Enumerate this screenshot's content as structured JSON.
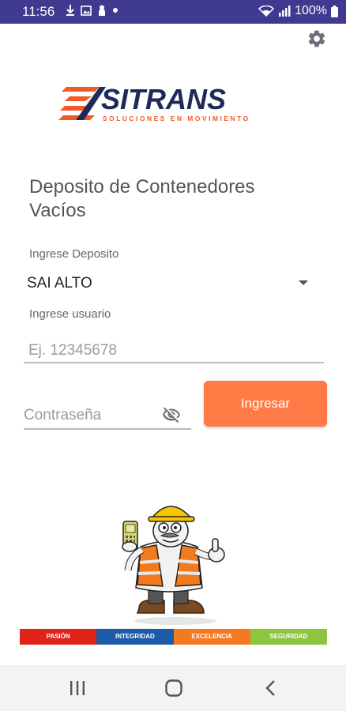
{
  "status_bar": {
    "time": "11:56",
    "battery": "100%",
    "background": "#3f3a8f"
  },
  "header": {
    "settings_icon": "gear-icon"
  },
  "logo": {
    "brand": "SITRANS",
    "tagline": "SOLUCIONES EN MOVIMIENTO"
  },
  "page": {
    "title": "Deposito de Contenedores Vacíos"
  },
  "form": {
    "deposito_label": "Ingrese Deposito",
    "deposito_value": "SAI ALTO",
    "usuario_label": "Ingrese usuario",
    "usuario_placeholder": "Ej. 12345678",
    "password_placeholder": "Contraseña",
    "submit_label": "Ingresar",
    "accent": "#ff7a45"
  },
  "values_bar": [
    {
      "label": "PASIÓN",
      "color": "#e2231a"
    },
    {
      "label": "INTEGRIDAD",
      "color": "#1d5aa8"
    },
    {
      "label": "EXCELENCIA",
      "color": "#f47a20"
    },
    {
      "label": "SEGURIDAD",
      "color": "#8cc63f"
    }
  ],
  "nav_bar": {
    "items": [
      "recent-apps-icon",
      "home-icon",
      "back-icon"
    ]
  }
}
